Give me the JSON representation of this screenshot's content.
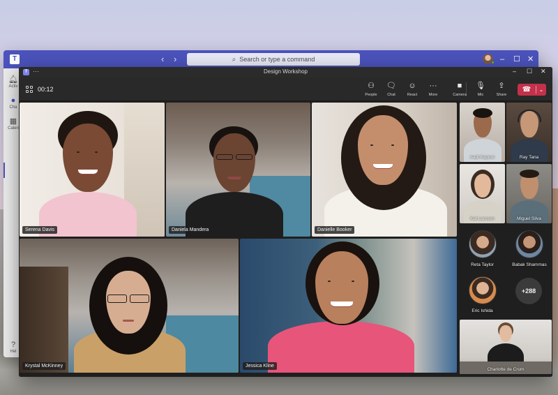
{
  "main_window": {
    "app_logo": "T",
    "search": {
      "placeholder": "Search or type a command",
      "icon": "search-icon"
    },
    "left_rail": [
      {
        "label": "Activ",
        "icon": "bell-icon"
      },
      {
        "label": "Cha",
        "icon": "chat-icon",
        "active": true
      },
      {
        "label": "Calen",
        "icon": "calendar-icon"
      },
      {
        "label": "Hel",
        "icon": "help-icon"
      }
    ]
  },
  "meeting_window": {
    "title": "Design Workshop",
    "more_glyph": "···",
    "timer": "00:12",
    "toolbar": {
      "people": "People",
      "chat": "Chat",
      "react": "React",
      "more": "More",
      "camera": "Camera",
      "mic": "Mic",
      "share": "Share"
    },
    "leave_color": "#c4314b"
  },
  "participants": {
    "main_tiles": [
      {
        "name": "Serena Davis"
      },
      {
        "name": "Daniela Mandera"
      },
      {
        "name": "Danielle Booker"
      },
      {
        "name": "Krystal McKinney"
      },
      {
        "name": "Jessica Kline"
      }
    ],
    "side_tiles": [
      {
        "name": "Aadi Kapoor"
      },
      {
        "name": "Ray Tana"
      },
      {
        "name": "Kat Larsson"
      },
      {
        "name": "Miguel Silva"
      }
    ],
    "avatars": [
      {
        "name": "Reta Taylor"
      },
      {
        "name": "Babak Shammas"
      },
      {
        "name": "Eric Ishida"
      }
    ],
    "overflow_count": "+288",
    "spotlight": {
      "name": "Charlotte de Crum"
    }
  },
  "colors": {
    "teams_purple": "#4b53bc",
    "meeting_bg": "#1f1f1f",
    "toolbar_bg": "#292929"
  }
}
